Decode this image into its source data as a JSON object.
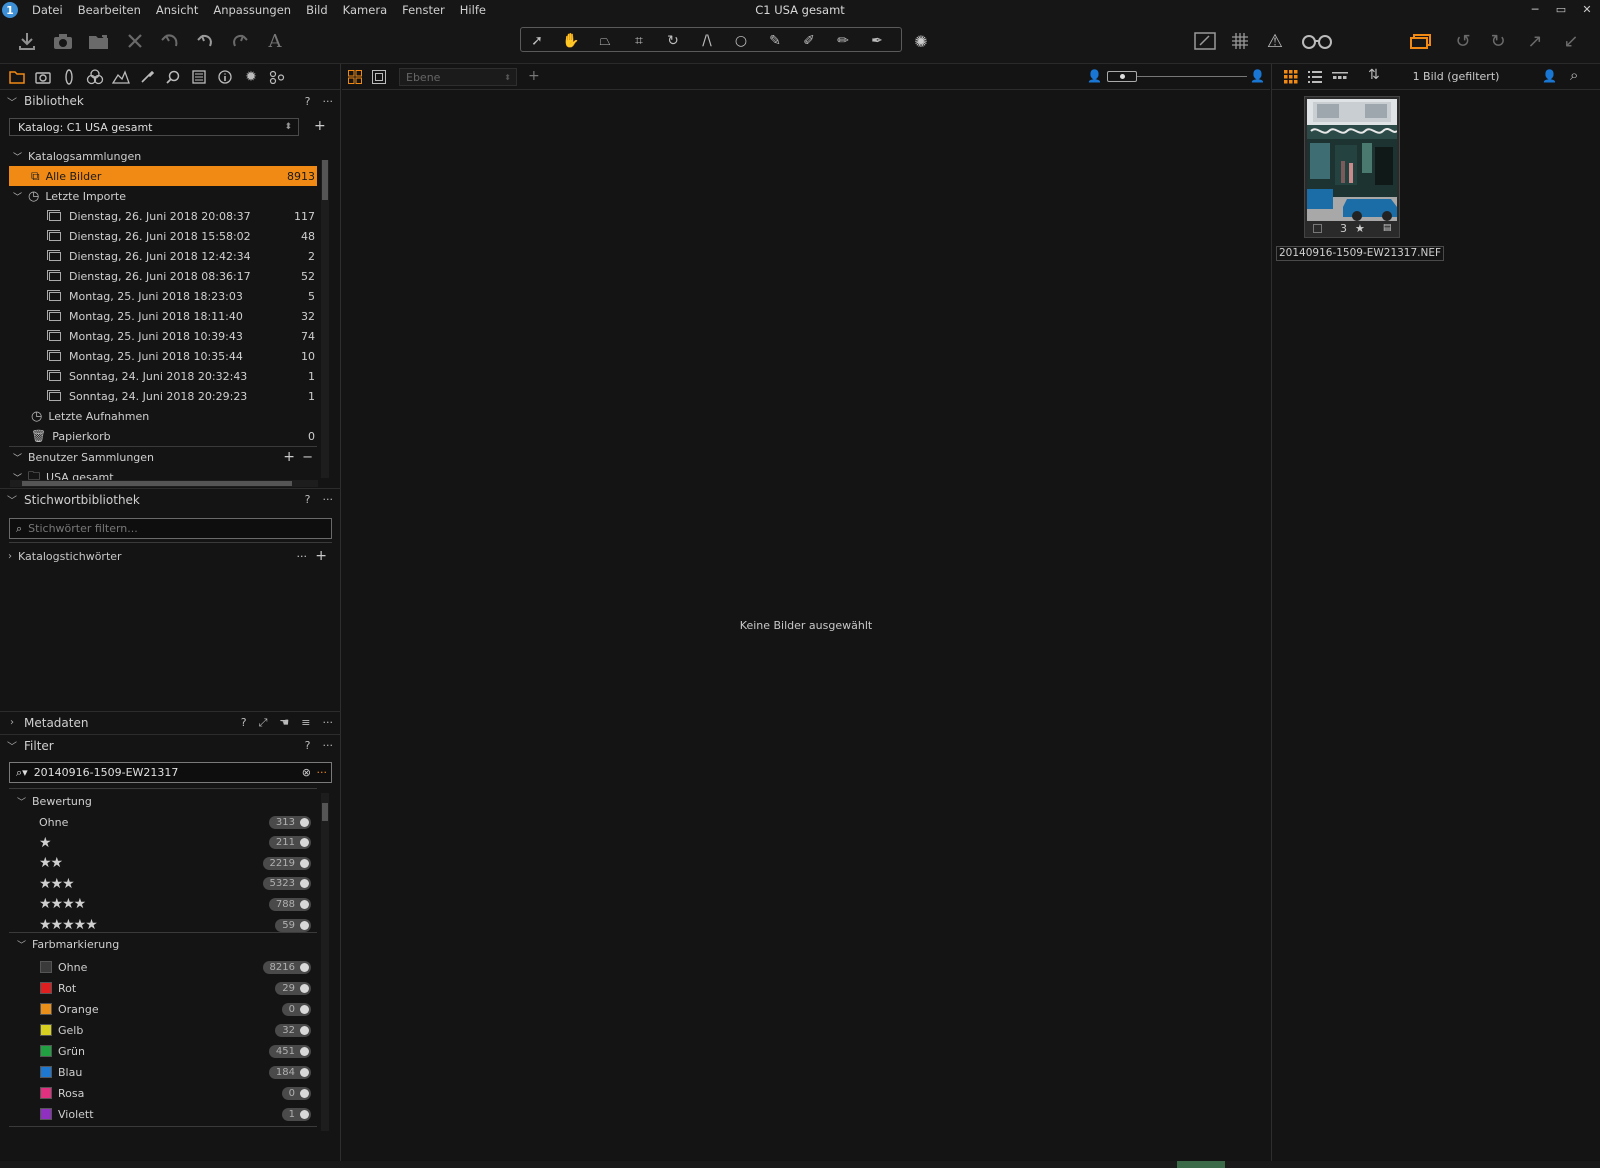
{
  "app": {
    "title": "C1 USA gesamt",
    "logo_letter": "1",
    "window_controls": [
      "─",
      "▭",
      "✕"
    ]
  },
  "menu": [
    "Datei",
    "Bearbeiten",
    "Ansicht",
    "Anpassungen",
    "Bild",
    "Kamera",
    "Fenster",
    "Hilfe"
  ],
  "icons": {
    "toolbar_left": [
      "import-icon",
      "camera-capture-icon",
      "export-icon",
      "delete-icon",
      "undo-all-icon",
      "undo-icon",
      "redo-icon",
      "text-icon"
    ],
    "cursor_tools": [
      "select-cursor-icon",
      "pan-hand-icon",
      "keystone-icon",
      "crop-icon",
      "rotate-icon",
      "straighten-icon",
      "circle-mask-icon",
      "brush-icon",
      "picker-icon",
      "erase-icon",
      "gradient-icon",
      "spot-icon"
    ],
    "toolbar_right": [
      "edit-mask-icon",
      "grid-icon",
      "exposure-warning-icon",
      "proof-glasses-icon",
      "multi-variant-icon",
      "reset-icon",
      "rotate-icon",
      "share-icon",
      "import-icon"
    ],
    "tool_tabs": [
      "library-tab-icon",
      "capture-tab-icon",
      "lens-tab-icon",
      "color-tab-icon",
      "exposure-tab-icon",
      "details-tab-icon",
      "zoom-tab-icon",
      "metadata-tab-icon",
      "info-tab-icon",
      "settings-tab-icon",
      "batch-tab-icon"
    ]
  },
  "library": {
    "header": "Bibliothek",
    "catalog_select": "Katalog: C1 USA gesamt",
    "catalog_collections": "Katalogsammlungen",
    "all_images": {
      "label": "Alle Bilder",
      "count": "8913"
    },
    "recent_imports": "Letzte Importe",
    "imports": [
      {
        "label": "Dienstag, 26. Juni 2018 20:08:37",
        "count": "117"
      },
      {
        "label": "Dienstag, 26. Juni 2018 15:58:02",
        "count": "48"
      },
      {
        "label": "Dienstag, 26. Juni 2018 12:42:34",
        "count": "2"
      },
      {
        "label": "Dienstag, 26. Juni 2018 08:36:17",
        "count": "52"
      },
      {
        "label": "Montag, 25. Juni 2018 18:23:03",
        "count": "5"
      },
      {
        "label": "Montag, 25. Juni 2018 18:11:40",
        "count": "32"
      },
      {
        "label": "Montag, 25. Juni 2018 10:39:43",
        "count": "74"
      },
      {
        "label": "Montag, 25. Juni 2018 10:35:44",
        "count": "10"
      },
      {
        "label": "Sonntag, 24. Juni 2018 20:32:43",
        "count": "1"
      },
      {
        "label": "Sonntag, 24. Juni 2018 20:29:23",
        "count": "1"
      }
    ],
    "recent_captures": "Letzte Aufnahmen",
    "trash": {
      "label": "Papierkorb",
      "count": "0"
    },
    "user_collections": "Benutzer Sammlungen",
    "usa_folder": "USA gesamt"
  },
  "keywords": {
    "header": "Stichwortbibliothek",
    "search_placeholder": "Stichwörter filtern...",
    "catalog_keywords": "Katalogstichwörter"
  },
  "metadata": {
    "header": "Metadaten"
  },
  "filter": {
    "header": "Filter",
    "search_value": "20140916-1509-EW21317",
    "rating_section": "Bewertung",
    "ratings": [
      {
        "label": "Ohne",
        "stars": "",
        "count": "313"
      },
      {
        "label": "",
        "stars": "★",
        "count": "211"
      },
      {
        "label": "",
        "stars": "★★",
        "count": "2219"
      },
      {
        "label": "",
        "stars": "★★★",
        "count": "5323"
      },
      {
        "label": "",
        "stars": "★★★★",
        "count": "788"
      },
      {
        "label": "",
        "stars": "★★★★★",
        "count": "59"
      }
    ],
    "color_section": "Farbmarkierung",
    "colors": [
      {
        "label": "Ohne",
        "color": "#3a3a3a",
        "count": "8216"
      },
      {
        "label": "Rot",
        "color": "#e02020",
        "count": "29"
      },
      {
        "label": "Orange",
        "color": "#e8901a",
        "count": "0"
      },
      {
        "label": "Gelb",
        "color": "#d8d020",
        "count": "32"
      },
      {
        "label": "Grün",
        "color": "#20a040",
        "count": "451"
      },
      {
        "label": "Blau",
        "color": "#1e78d0",
        "count": "184"
      },
      {
        "label": "Rosa",
        "color": "#e03080",
        "count": "0"
      },
      {
        "label": "Violett",
        "color": "#9030c0",
        "count": "1"
      }
    ]
  },
  "viewer": {
    "layer_select": "Ebene",
    "empty_message": "Keine Bilder ausgewählt"
  },
  "browser": {
    "count_label": "1 Bild (gefiltert)",
    "thumbnail": {
      "filename": "20140916-1509-EW21317.NEF",
      "rating_number": "3",
      "star": "★"
    }
  },
  "colors": {
    "accent": "#f08a15",
    "bg": "#141414",
    "panel_border": "#2e2e2e"
  }
}
